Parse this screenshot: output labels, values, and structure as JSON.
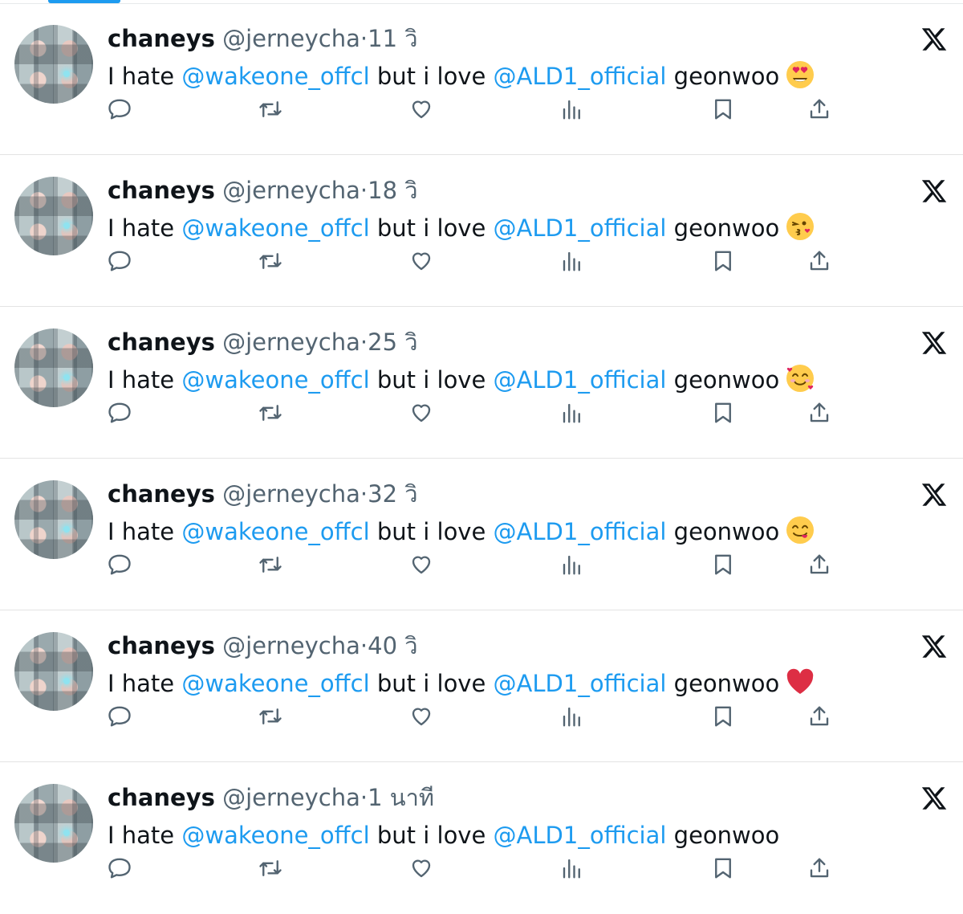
{
  "tweets": [
    {
      "name": "chaneys",
      "handle": "@jerneycha",
      "dot": "·",
      "time": "11 วิ",
      "text_before": "I hate ",
      "mention1": "@wakeone_offcl",
      "text_mid": " but i love ",
      "mention2": "@ALD1_official",
      "text_after": " geonwoo",
      "emoji": "heart-eyes-emoji"
    },
    {
      "name": "chaneys",
      "handle": "@jerneycha",
      "dot": "·",
      "time": "18 วิ",
      "text_before": "I hate ",
      "mention1": "@wakeone_offcl",
      "text_mid": " but i love ",
      "mention2": "@ALD1_official",
      "text_after": " geonwoo",
      "emoji": "kissing-heart-emoji"
    },
    {
      "name": "chaneys",
      "handle": "@jerneycha",
      "dot": "·",
      "time": "25 วิ",
      "text_before": "I hate ",
      "mention1": "@wakeone_offcl",
      "text_mid": " but i love ",
      "mention2": "@ALD1_official",
      "text_after": " geonwoo",
      "emoji": "smiling-hearts-emoji"
    },
    {
      "name": "chaneys",
      "handle": "@jerneycha",
      "dot": "·",
      "time": "32 วิ",
      "text_before": "I hate ",
      "mention1": "@wakeone_offcl",
      "text_mid": " but i love ",
      "mention2": "@ALD1_official",
      "text_after": " geonwoo",
      "emoji": "yum-face-emoji"
    },
    {
      "name": "chaneys",
      "handle": "@jerneycha",
      "dot": "·",
      "time": "40 วิ",
      "text_before": "I hate ",
      "mention1": "@wakeone_offcl",
      "text_mid": " but i love ",
      "mention2": "@ALD1_official",
      "text_after": " geonwoo",
      "emoji": "red-heart-emoji"
    },
    {
      "name": "chaneys",
      "handle": "@jerneycha",
      "dot": "·",
      "time": "1 นาที",
      "text_before": "I hate ",
      "mention1": "@wakeone_offcl",
      "text_mid": " but i love ",
      "mention2": "@ALD1_official",
      "text_after": " geonwoo",
      "emoji": ""
    }
  ],
  "actions": [
    "reply-icon",
    "retweet-icon",
    "like-icon",
    "views-icon",
    "bookmark-icon",
    "share-icon"
  ],
  "colors": {
    "accent": "#1d9bf0",
    "text": "#0f1419",
    "muted": "#536471",
    "divider": "#e3e3e3"
  }
}
